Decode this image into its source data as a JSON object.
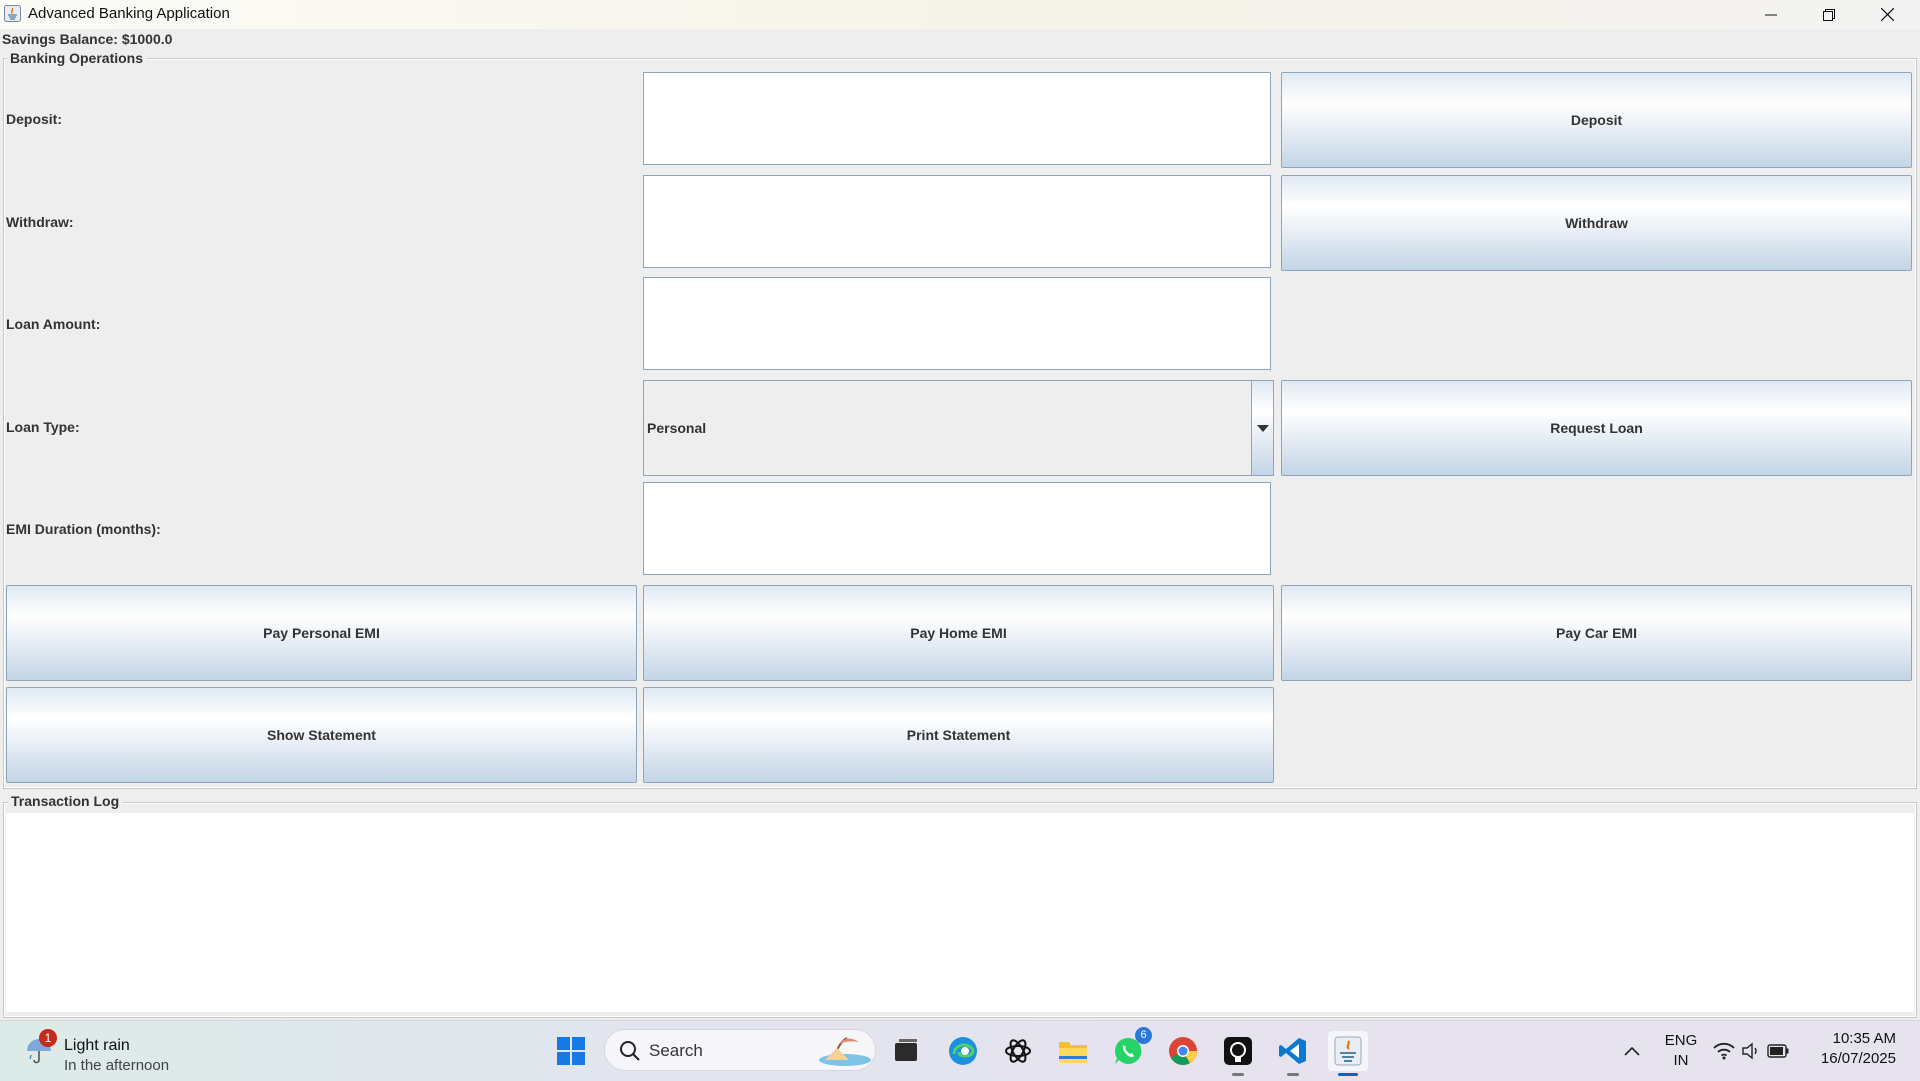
{
  "window": {
    "title": "Advanced Banking Application"
  },
  "balance_text": "Savings Balance: $1000.0",
  "operations": {
    "group_title": "Banking Operations",
    "deposit_label": "Deposit:",
    "deposit_value": "",
    "deposit_button": "Deposit",
    "withdraw_label": "Withdraw:",
    "withdraw_value": "",
    "withdraw_button": "Withdraw",
    "loan_amount_label": "Loan Amount:",
    "loan_amount_value": "",
    "loan_type_label": "Loan Type:",
    "loan_type_selected": "Personal",
    "request_loan_button": "Request Loan",
    "emi_duration_label": "EMI Duration (months):",
    "emi_duration_value": "",
    "pay_personal_emi_button": "Pay Personal EMI",
    "pay_home_emi_button": "Pay Home EMI",
    "pay_car_emi_button": "Pay Car EMI",
    "show_statement_button": "Show Statement",
    "print_statement_button": "Print Statement"
  },
  "log": {
    "group_title": "Transaction Log",
    "content": ""
  },
  "taskbar": {
    "weather_badge": "1",
    "weather_main": "Light rain",
    "weather_sub": "In the afternoon",
    "search_label": "Search",
    "whatsapp_badge": "6",
    "lang_line1": "ENG",
    "lang_line2": "IN",
    "time": "10:35 AM",
    "date": "16/07/2025"
  },
  "colors": {
    "window_bg": "#eeeeee",
    "button_border": "#8ea6bd",
    "button_gradient_bottom": "#c3d5e6",
    "taskbar_accent": "#0a64c8"
  }
}
